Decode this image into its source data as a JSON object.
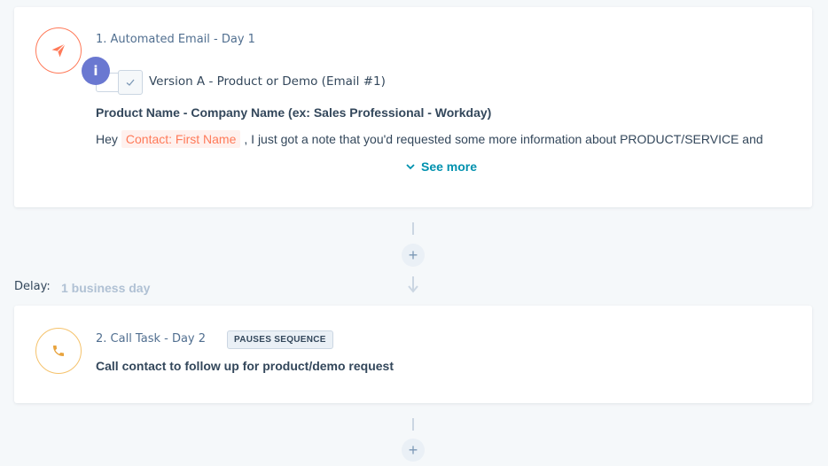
{
  "steps": [
    {
      "title": "1. Automated Email - Day 1",
      "icon": "paper-plane-icon",
      "info_badge": "i",
      "version_label": "Version A - Product or Demo (Email #1)",
      "subject": "Product Name - Company Name (ex: Sales Professional - Workday)",
      "body_prefix": "Hey",
      "token": "Contact: First Name",
      "body_suffix": ", I just got a note that you'd requested some more information about PRODUCT/SERVICE and",
      "see_more": "See more"
    },
    {
      "title": "2. Call Task - Day 2",
      "icon": "phone-icon",
      "badge": "PAUSES SEQUENCE",
      "description": "Call contact to follow up for product/demo request"
    }
  ],
  "delay": {
    "label": "Delay:",
    "value": "1 business day"
  },
  "add_symbol": "+",
  "colors": {
    "email_accent": "#ff7a59",
    "call_accent": "#f5c26b",
    "link": "#0091ae",
    "info": "#6a78d1"
  }
}
